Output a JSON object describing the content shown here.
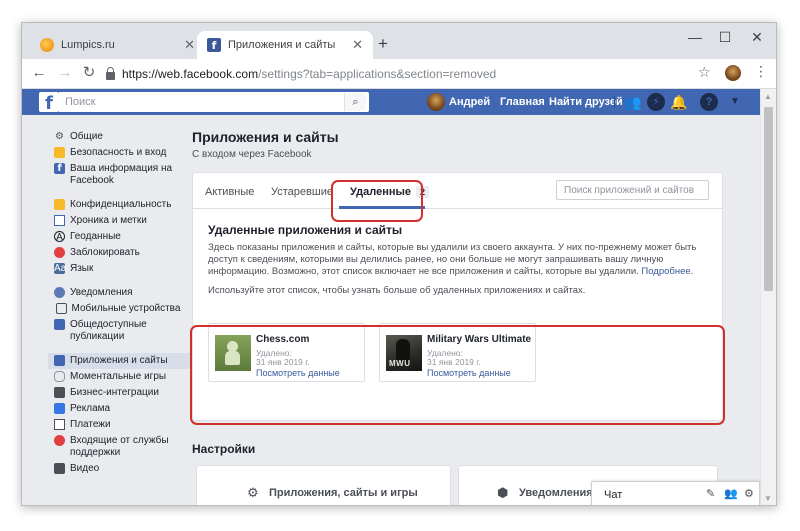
{
  "browser": {
    "tabs": [
      {
        "title": "Lumpics.ru",
        "active": false
      },
      {
        "title": "Приложения и сайты",
        "active": true
      }
    ],
    "url_host": "https://web.facebook.com",
    "url_path": "/settings?tab=applications&section=removed"
  },
  "fb_header": {
    "search_placeholder": "Поиск",
    "user_name": "Андрей",
    "home_label": "Главная",
    "find_friends_label": "Найти друзей"
  },
  "sidebar": {
    "groups": [
      [
        {
          "label": "Общие",
          "icon": "gear-icon"
        },
        {
          "label": "Безопасность и вход",
          "icon": "shield-icon"
        },
        {
          "label": "Ваша информация на Facebook",
          "icon": "facebook-icon"
        }
      ],
      [
        {
          "label": "Конфиденциальность",
          "icon": "lock-icon"
        },
        {
          "label": "Хроника и метки",
          "icon": "timeline-icon"
        },
        {
          "label": "Геоданные",
          "icon": "location-icon"
        },
        {
          "label": "Заблокировать",
          "icon": "block-icon"
        },
        {
          "label": "Язык",
          "icon": "language-icon"
        }
      ],
      [
        {
          "label": "Уведомления",
          "icon": "globe-icon"
        },
        {
          "label": "Мобильные устройства",
          "icon": "mobile-icon"
        },
        {
          "label": "Общедоступные публикации",
          "icon": "rss-icon"
        }
      ],
      [
        {
          "label": "Приложения и сайты",
          "icon": "apps-icon",
          "active": true
        },
        {
          "label": "Моментальные игры",
          "icon": "games-icon"
        },
        {
          "label": "Бизнес-интеграции",
          "icon": "business-icon"
        },
        {
          "label": "Реклама",
          "icon": "ads-icon"
        },
        {
          "label": "Платежи",
          "icon": "payments-icon"
        },
        {
          "label": "Входящие от службы поддержки",
          "icon": "support-inbox-icon"
        },
        {
          "label": "Видео",
          "icon": "video-icon"
        }
      ]
    ]
  },
  "main": {
    "title": "Приложения и сайты",
    "subtitle": "С входом через Facebook",
    "tabs": {
      "active_label": "Активные",
      "expired_label": "Устаревшие",
      "removed_label": "Удаленные",
      "removed_count": "2"
    },
    "app_search_placeholder": "Поиск приложений и сайтов",
    "section_title": "Удаленные приложения и сайты",
    "description": "Здесь показаны приложения и сайты, которые вы удалили из своего аккаунта. У них по-прежнему может быть доступ к сведениям, которыми вы делились ранее, но они больше не могут запрашивать вашу личную информацию. Возможно, этот список включает не все приложения и сайты, которые вы удалили.",
    "description_link": "Подробнее.",
    "description2": "Используйте этот список, чтобы узнать больше об удаленных приложениях и сайтах.",
    "apps": [
      {
        "name": "Chess.com",
        "status": "Удалено:",
        "date": "31 янв 2019 г.",
        "link": "Посмотреть данные",
        "thumb_text": ""
      },
      {
        "name": "Military Wars Ultimate",
        "status": "Удалено:",
        "date": "31 янв 2019 г.",
        "link": "Посмотреть данные",
        "thumb_text": "MWU"
      }
    ],
    "settings_title": "Настройки",
    "settings_cards": [
      {
        "label": "Приложения, сайты и игры"
      },
      {
        "label": "Уведомления из"
      }
    ]
  },
  "chat": {
    "label": "Чат"
  },
  "colors": {
    "fb_blue": "#4267b2",
    "link": "#385898",
    "highlight_red": "#d32f2f",
    "page_bg": "#e9ebee"
  }
}
